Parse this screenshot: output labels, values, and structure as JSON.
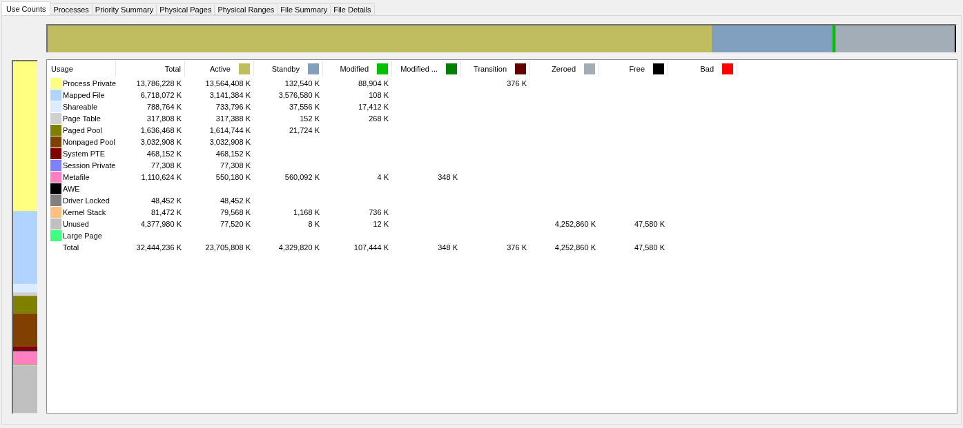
{
  "tabs": [
    {
      "label": "Use Counts",
      "selected": true
    },
    {
      "label": "Processes",
      "selected": false
    },
    {
      "label": "Priority Summary",
      "selected": false
    },
    {
      "label": "Physical Pages",
      "selected": false
    },
    {
      "label": "Physical Ranges",
      "selected": false
    },
    {
      "label": "File Summary",
      "selected": false
    },
    {
      "label": "File Details",
      "selected": false
    }
  ],
  "table": {
    "columns": [
      {
        "label": "Usage"
      },
      {
        "label": "Total"
      },
      {
        "label": "Active",
        "color": "#bfbd60"
      },
      {
        "label": "Standby",
        "color": "#819fbf"
      },
      {
        "label": "Modified",
        "color": "#00c000"
      },
      {
        "label": "Modified ...",
        "color": "#008000"
      },
      {
        "label": "Transition",
        "color": "#600000"
      },
      {
        "label": "Zeroed",
        "color": "#a3adb8"
      },
      {
        "label": "Free",
        "color": "#000000"
      },
      {
        "label": "Bad",
        "color": "#ff0000"
      }
    ],
    "rows": [
      {
        "color": "#ffff80",
        "cells": [
          "Process Private",
          "13,786,228 K",
          "13,564,408 K",
          "132,540 K",
          "88,904 K",
          "",
          "376 K",
          "",
          "",
          ""
        ]
      },
      {
        "color": "#b0d4ff",
        "cells": [
          "Mapped File",
          "6,718,072 K",
          "3,141,384 K",
          "3,576,580 K",
          "108 K",
          "",
          "",
          "",
          "",
          ""
        ]
      },
      {
        "color": "#dcebff",
        "cells": [
          "Shareable",
          "788,764 K",
          "733,796 K",
          "37,556 K",
          "17,412 K",
          "",
          "",
          "",
          "",
          ""
        ]
      },
      {
        "color": "#d0d0d0",
        "cells": [
          "Page Table",
          "317,808 K",
          "317,388 K",
          "152 K",
          "268 K",
          "",
          "",
          "",
          "",
          ""
        ]
      },
      {
        "color": "#808000",
        "cells": [
          "Paged Pool",
          "1,636,468 K",
          "1,614,744 K",
          "21,724 K",
          "",
          "",
          "",
          "",
          "",
          ""
        ]
      },
      {
        "color": "#804000",
        "cells": [
          "Nonpaged Pool",
          "3,032,908 K",
          "3,032,908 K",
          "",
          "",
          "",
          "",
          "",
          "",
          ""
        ]
      },
      {
        "color": "#800000",
        "cells": [
          "System PTE",
          "468,152 K",
          "468,152 K",
          "",
          "",
          "",
          "",
          "",
          "",
          ""
        ]
      },
      {
        "color": "#8080ff",
        "cells": [
          "Session Private",
          "77,308 K",
          "77,308 K",
          "",
          "",
          "",
          "",
          "",
          "",
          ""
        ]
      },
      {
        "color": "#ff80c0",
        "cells": [
          "Metafile",
          "1,110,624 K",
          "550,180 K",
          "560,092 K",
          "4 K",
          "348 K",
          "",
          "",
          "",
          ""
        ]
      },
      {
        "color": "#000000",
        "cells": [
          "AWE",
          "",
          "",
          "",
          "",
          "",
          "",
          "",
          "",
          ""
        ]
      },
      {
        "color": "#808080",
        "cells": [
          "Driver Locked",
          "48,452 K",
          "48,452 K",
          "",
          "",
          "",
          "",
          "",
          "",
          ""
        ]
      },
      {
        "color": "#ffc080",
        "cells": [
          "Kernel Stack",
          "81,472 K",
          "79,568 K",
          "1,168 K",
          "736 K",
          "",
          "",
          "",
          "",
          ""
        ]
      },
      {
        "color": "#c0c0c0",
        "cells": [
          "Unused",
          "4,377,980 K",
          "77,520 K",
          "8 K",
          "12 K",
          "",
          "",
          "4,252,860 K",
          "47,580 K",
          ""
        ]
      },
      {
        "color": "#40ff80",
        "cells": [
          "Large Page",
          "",
          "",
          "",
          "",
          "",
          "",
          "",
          "",
          ""
        ]
      },
      {
        "cells": [
          "Total",
          "32,444,236 K",
          "23,705,808 K",
          "4,329,820 K",
          "107,444 K",
          "348 K",
          "376 K",
          "4,252,860 K",
          "47,580 K",
          ""
        ]
      }
    ]
  }
}
